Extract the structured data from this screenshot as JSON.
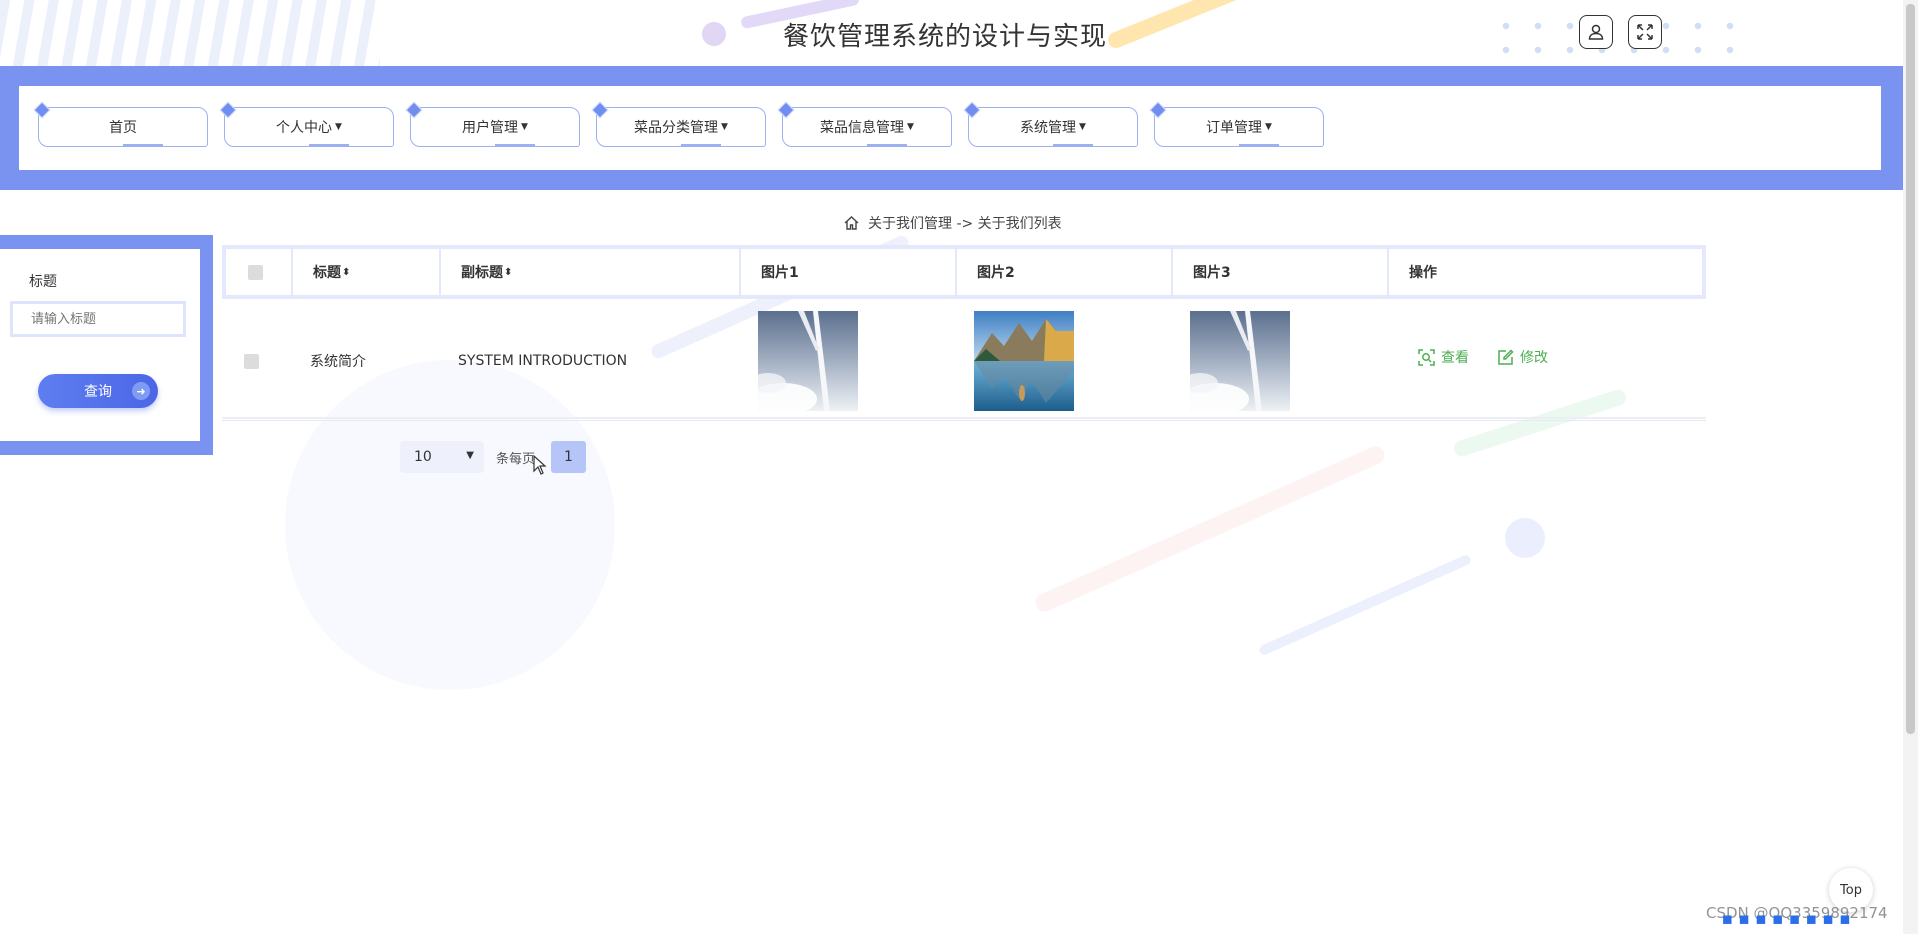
{
  "header": {
    "title": "餐饮管理系统的设计与实现",
    "user_icon": "user-icon",
    "fullscreen_icon": "fullscreen-icon"
  },
  "nav": {
    "items": [
      {
        "label": "首页",
        "has_dropdown": false
      },
      {
        "label": "个人中心",
        "has_dropdown": true
      },
      {
        "label": "用户管理",
        "has_dropdown": true
      },
      {
        "label": "菜品分类管理",
        "has_dropdown": true
      },
      {
        "label": "菜品信息管理",
        "has_dropdown": true
      },
      {
        "label": "系统管理",
        "has_dropdown": true
      },
      {
        "label": "订单管理",
        "has_dropdown": true
      }
    ],
    "caret": "▼"
  },
  "breadcrumb": {
    "icon": "home-icon",
    "text": "关于我们管理 -> 关于我们列表"
  },
  "search": {
    "label": "标题",
    "placeholder": "请输入标题",
    "button_label": "查询"
  },
  "table": {
    "columns": [
      "标题",
      "副标题",
      "图片1",
      "图片2",
      "图片3",
      "操作"
    ],
    "sort_glyph": "⬍",
    "rows": [
      {
        "title": "系统简介",
        "subtitle": "SYSTEM INTRODUCTION",
        "images": [
          "wind-turbine-sky",
          "mountain-lake",
          "wind-turbine-sky"
        ],
        "actions": {
          "view": "查看",
          "edit": "修改"
        }
      }
    ]
  },
  "pagination": {
    "page_size": "10",
    "per_page_label": "条每页",
    "current_page": "1"
  },
  "misc": {
    "top_button": "Top",
    "watermark": "CSDN @QQ3359892174"
  },
  "colors": {
    "accent": "#7b93f0",
    "action_green": "#4caf50",
    "button_blue": "#5d7ef0"
  }
}
